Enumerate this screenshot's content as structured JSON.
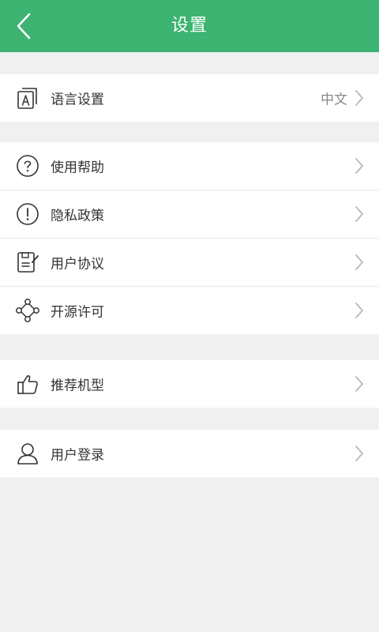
{
  "header": {
    "title": "设置",
    "back_icon": "chevron-left-icon"
  },
  "colors": {
    "header_bg": "#3cb371",
    "background": "#f0f0f0",
    "text": "#333333",
    "secondary_text": "#888888"
  },
  "language": {
    "label": "语言设置",
    "value": "中文",
    "icon": "language-icon"
  },
  "info": {
    "items": [
      {
        "label": "使用帮助",
        "icon": "help-icon"
      },
      {
        "label": "隐私政策",
        "icon": "privacy-icon"
      },
      {
        "label": "用户协议",
        "icon": "agreement-icon"
      },
      {
        "label": "开源许可",
        "icon": "open-source-icon"
      }
    ]
  },
  "recommend": {
    "label": "推荐机型",
    "icon": "thumbs-up-icon"
  },
  "account": {
    "label": "用户登录",
    "icon": "user-icon"
  }
}
